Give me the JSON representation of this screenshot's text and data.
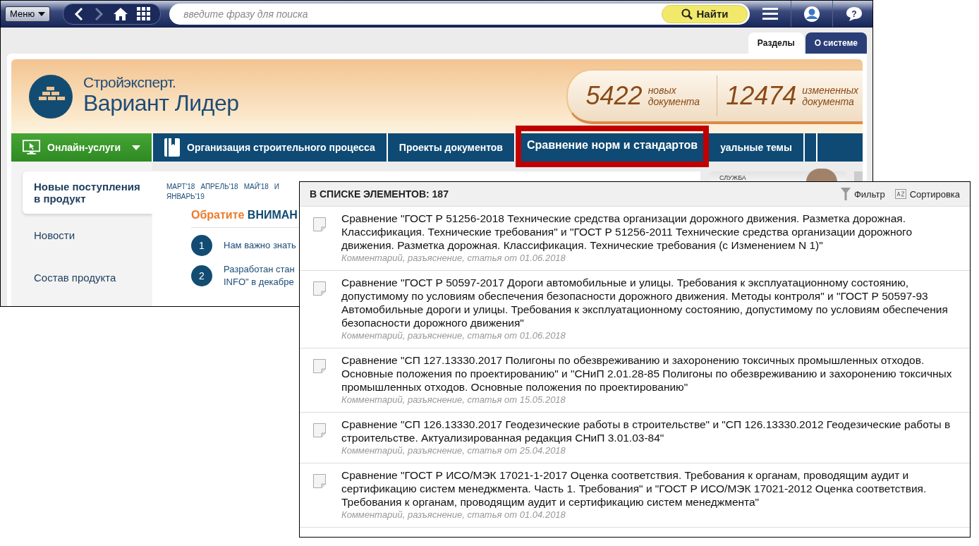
{
  "toolbar": {
    "menu_button": "Меню",
    "search": {
      "placeholder": "введите фразу для поиска"
    },
    "search_button": "Найти",
    "help_glyph": "?"
  },
  "tabs": [
    {
      "label": "Разделы",
      "selected": true
    },
    {
      "label": "О системе",
      "selected": false
    }
  ],
  "logo": {
    "line1": "Стройэксперт.",
    "line2": "Вариант Лидер"
  },
  "stats": [
    {
      "count": "5422",
      "label": "новых документа"
    },
    {
      "count": "12474",
      "label": "измененных документа"
    }
  ],
  "nav": [
    {
      "label": "Онлайн-услуги",
      "kind": "dropdown",
      "highlighted": false
    },
    {
      "label": "Организация строительного процесса",
      "kind": "book",
      "highlighted": false
    },
    {
      "label": "Проекты документов",
      "kind": "plain",
      "highlighted": false
    },
    {
      "label": "Сравнение норм и стандартов",
      "kind": "plain",
      "highlighted": true
    },
    {
      "label": "уальные темы",
      "kind": "plain",
      "highlighted": false
    }
  ],
  "sidebar": [
    {
      "label": "Новые поступления в продукт",
      "selected": true
    },
    {
      "label": "Новости",
      "selected": false
    },
    {
      "label": "Состав продукта",
      "selected": false
    }
  ],
  "months": [
    "МАРТ'18",
    "АПРЕЛЬ'18",
    "МАЙ'18",
    "И",
    "ЯНВАРЬ'19"
  ],
  "notice": {
    "accent": "Обратите",
    "text": "ВНИМАН"
  },
  "notice_items": [
    {
      "number": "1",
      "lines": [
        "Нам важно знать"
      ]
    },
    {
      "number": "2",
      "lines": [
        "Разработан стан",
        "INFO\" в декабре"
      ]
    }
  ],
  "service_card": {
    "title": "СЛУЖБА"
  },
  "list": {
    "count_label": "В СПИСКЕ ЭЛЕМЕНТОВ: 187",
    "filter": "Фильтр",
    "sort": "Сортировка",
    "items": [
      {
        "title": "Сравнение \"ГОСТ Р 51256-2018 Технические средства организации дорожного движения. Разметка дорожная. Классификация. Технические требования\" и \"ГОСТ Р 51256-2011 Технические средства организации дорожного движения. Разметка дорожная. Классификация. Технические требования (с Изменением N 1)\"",
        "meta": "Комментарий, разъяснение, статья от 01.06.2018"
      },
      {
        "title": "Сравнение \"ГОСТ Р 50597-2017 Дороги автомобильные и улицы. Требования к эксплуатационному состоянию, допустимому по условиям обеспечения безопасности дорожного движения. Методы контроля\" и \"ГОСТ Р 50597-93 Автомобильные дороги и улицы. Требования к эксплуатационному состоянию, допустимому по условиям обеспечения безопасности дорожного движения\"",
        "meta": "Комментарий, разъяснение, статья от 01.06.2018"
      },
      {
        "title": "Сравнение \"СП 127.13330.2017 Полигоны по обезвреживанию и захоронению токсичных промышленных отходов. Основные положения по проектированию\" и \"СНиП 2.01.28-85 Полигоны по обезвреживанию и захоронению токсичных промышленных отходов. Основные положения по проектированию\"",
        "meta": "Комментарий, разъяснение, статья от 15.05.2018"
      },
      {
        "title": "Сравнение \"СП 126.13330.2017 Геодезические работы в строительстве\" и \"СП 126.13330.2012 Геодезические работы в строительстве. Актуализированная редакция СНиП 3.01.03-84\"",
        "meta": "Комментарий, разъяснение, статья от 25.04.2018"
      },
      {
        "title": "Сравнение \"ГОСТ Р ИСО/МЭК 17021-1-2017 Оценка соответствия. Требования к органам, проводящим аудит и сертификацию систем менеджмента. Часть 1. Требования\" и \"ГОСТ Р ИСО/МЭК 17021-2012 Оценка соответствия. Требования к органам, проводящим аудит и сертификацию систем менеджмента\"",
        "meta": "Комментарий, разъяснение, статья от 01.04.2018"
      }
    ]
  }
}
